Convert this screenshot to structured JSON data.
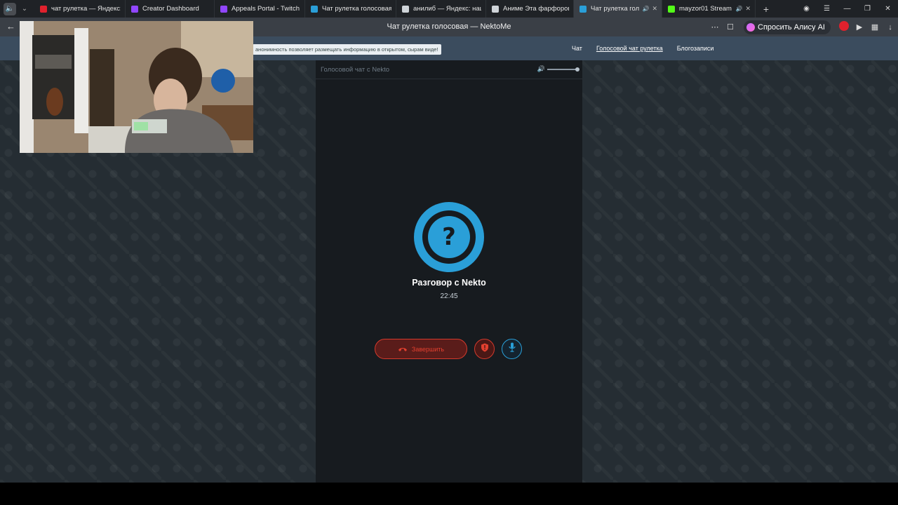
{
  "browser": {
    "tabs": [
      {
        "label": "чат рулетка — Яндекс: н",
        "icon": "yandex-icon",
        "color": "#e0212d",
        "active": false
      },
      {
        "label": "Creator Dashboard",
        "icon": "twitch-icon",
        "color": "#9146ff",
        "active": false
      },
      {
        "label": "Appeals Portal - Twitch",
        "icon": "twitch-icon",
        "color": "#9146ff",
        "active": false
      },
      {
        "label": "Чат рулетка голосовая -",
        "icon": "nekto-icon",
        "color": "#2a9fd8",
        "active": false
      },
      {
        "label": "анилиб — Яндекс: нашл",
        "icon": "document-icon",
        "color": "#cfd4d9",
        "active": false
      },
      {
        "label": "Аниме Эта фарфоровая",
        "icon": "anime-icon",
        "color": "#cfd4d9",
        "active": false
      },
      {
        "label": "Чат рулетка голос",
        "icon": "nekto-icon",
        "color": "#2a9fd8",
        "active": true
      },
      {
        "label": "mayzor01 Stream",
        "icon": "kick-icon",
        "color": "#53fc18",
        "active": false
      }
    ],
    "page_title": "Чат рулетка голосовая — NektoMe",
    "alice_label": "Спросить Алису AI"
  },
  "site": {
    "notice": "анонимность позволяет размещать информацию в открытом, сырам виде!",
    "nav": [
      {
        "label": "Чат",
        "current": false
      },
      {
        "label": "Голосовой чат рулетка",
        "current": true
      },
      {
        "label": "Блогозаписи",
        "current": false
      }
    ]
  },
  "chat": {
    "panel_title": "Голосовой чат с Nekto",
    "avatar_symbol": "?",
    "conversation_title": "Разговор с Nekto",
    "timer": "22:45",
    "end_label": "Завершить"
  },
  "colors": {
    "accent": "#2a9fd8",
    "danger": "#d33a2c",
    "header": "#3b4c5e",
    "panel": "#171b1f"
  }
}
